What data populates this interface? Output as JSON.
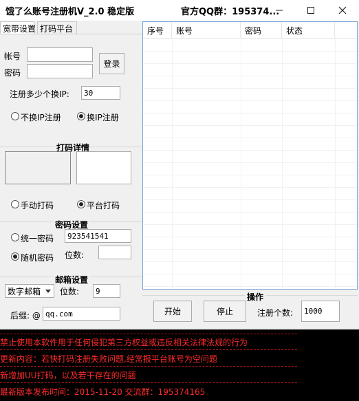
{
  "window": {
    "title": "饿了么账号注册机V_2.0 稳定版",
    "qq_group": "官方QQ群：195374..."
  },
  "tabs": [
    {
      "label": "宽带设置",
      "active": true
    },
    {
      "label": "打码平台",
      "active": false
    }
  ],
  "login": {
    "account_label": "帐号",
    "password_label": "密码",
    "account_value": "",
    "password_value": "",
    "login_button": "登录"
  },
  "ip_switch": {
    "label": "注册多少个换IP:",
    "value": "30",
    "option_no_switch": "不换IP注册",
    "option_switch": "换IP注册",
    "selected": "option_switch"
  },
  "captcha": {
    "section_title": "打码详情",
    "option_manual": "手动打码",
    "option_platform": "平台打码",
    "selected": "option_platform"
  },
  "password_settings": {
    "section_title": "密码设置",
    "option_uniform": "统一密码",
    "uniform_value": "923541541",
    "option_random": "随机密码",
    "digits_label": "位数:",
    "digits_value": "",
    "selected": "option_random"
  },
  "email_settings": {
    "section_title": "邮箱设置",
    "type_select": "数字邮箱",
    "digits_label": "位数:",
    "digits_value": "9",
    "suffix_label": "后缀: @",
    "suffix_value": "qq.com"
  },
  "table": {
    "columns": [
      "序号",
      "账号",
      "密码",
      "状态"
    ],
    "rows": []
  },
  "operations": {
    "section_title": "操作",
    "start_button": "开始",
    "stop_button": "停止",
    "count_label": "注册个数:",
    "count_value": "1000"
  },
  "log": {
    "lines": [
      "禁止使用本软件用于任何侵犯第三方权益或违反相关法律法规的行为",
      "更新内容：若快打码注册失败问题,经常报平台账号为空问题",
      "新增加UU打码，以及若干存在的问题",
      "最新版本发布时间：2015-11-20 交流群：195374165"
    ]
  },
  "colors": {
    "log_background": "#000000",
    "log_text": "#ff2a2a",
    "table_border": "#7aa7d6"
  }
}
